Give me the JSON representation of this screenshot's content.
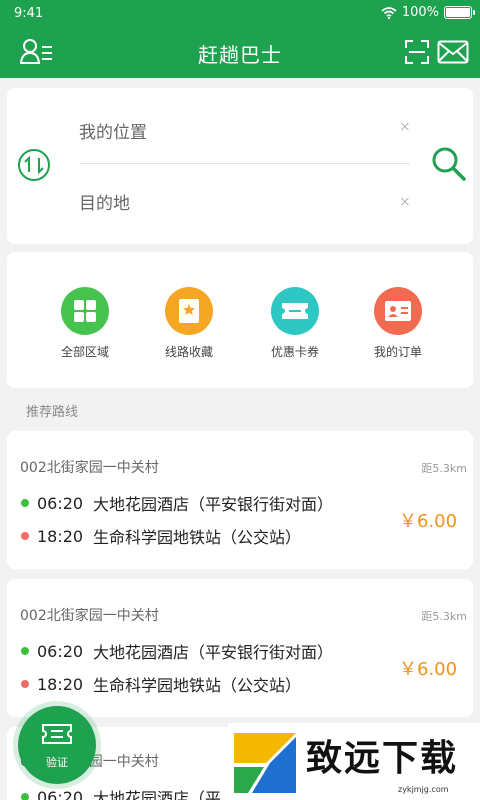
{
  "status_bar": {
    "time": "9:41",
    "battery": "100%"
  },
  "header": {
    "title": "赶趟巴士",
    "icons": [
      "user-list-icon",
      "scan-icon",
      "mail-icon"
    ]
  },
  "search": {
    "from_placeholder": "我的位置",
    "to_placeholder": "目的地",
    "clear_glyph": "×"
  },
  "menu": [
    {
      "label": "全部区域",
      "icon": "grid-icon",
      "color": "#46c34e"
    },
    {
      "label": "线路收藏",
      "icon": "star-bookmark-icon",
      "color": "#f5a623"
    },
    {
      "label": "优惠卡券",
      "icon": "ticket-icon",
      "color": "#2ec7c4"
    },
    {
      "label": "我的订单",
      "icon": "id-card-icon",
      "color": "#f26b51"
    }
  ],
  "section": {
    "title": "推荐路线"
  },
  "routes": [
    {
      "name": "002北街家园一中关村",
      "distance": "距5.3km",
      "dep_time": "06:20",
      "dep_stop": "大地花园酒店（平安银行街对面）",
      "arr_time": "18:20",
      "arr_stop": "生命科学园地铁站（公交站）",
      "price": "￥6.00"
    },
    {
      "name": "002北街家园一中关村",
      "distance": "距5.3km",
      "dep_time": "06:20",
      "dep_stop": "大地花园酒店（平安银行街对面）",
      "arr_time": "18:20",
      "arr_stop": "生命科学园地铁站（公交站）",
      "price": "￥6.00"
    },
    {
      "name": "002北街家园一中关村",
      "dep_time": "06:20",
      "dep_stop": "大地花园酒店（平"
    }
  ],
  "verify": {
    "label": "验证"
  },
  "watermark": {
    "text": "致远下载",
    "url": "zykjmjg.com"
  },
  "colors": {
    "primary": "#1ea24f",
    "price": "#f0921c",
    "start_dot": "#3cc03c",
    "end_dot": "#f06a6a"
  }
}
